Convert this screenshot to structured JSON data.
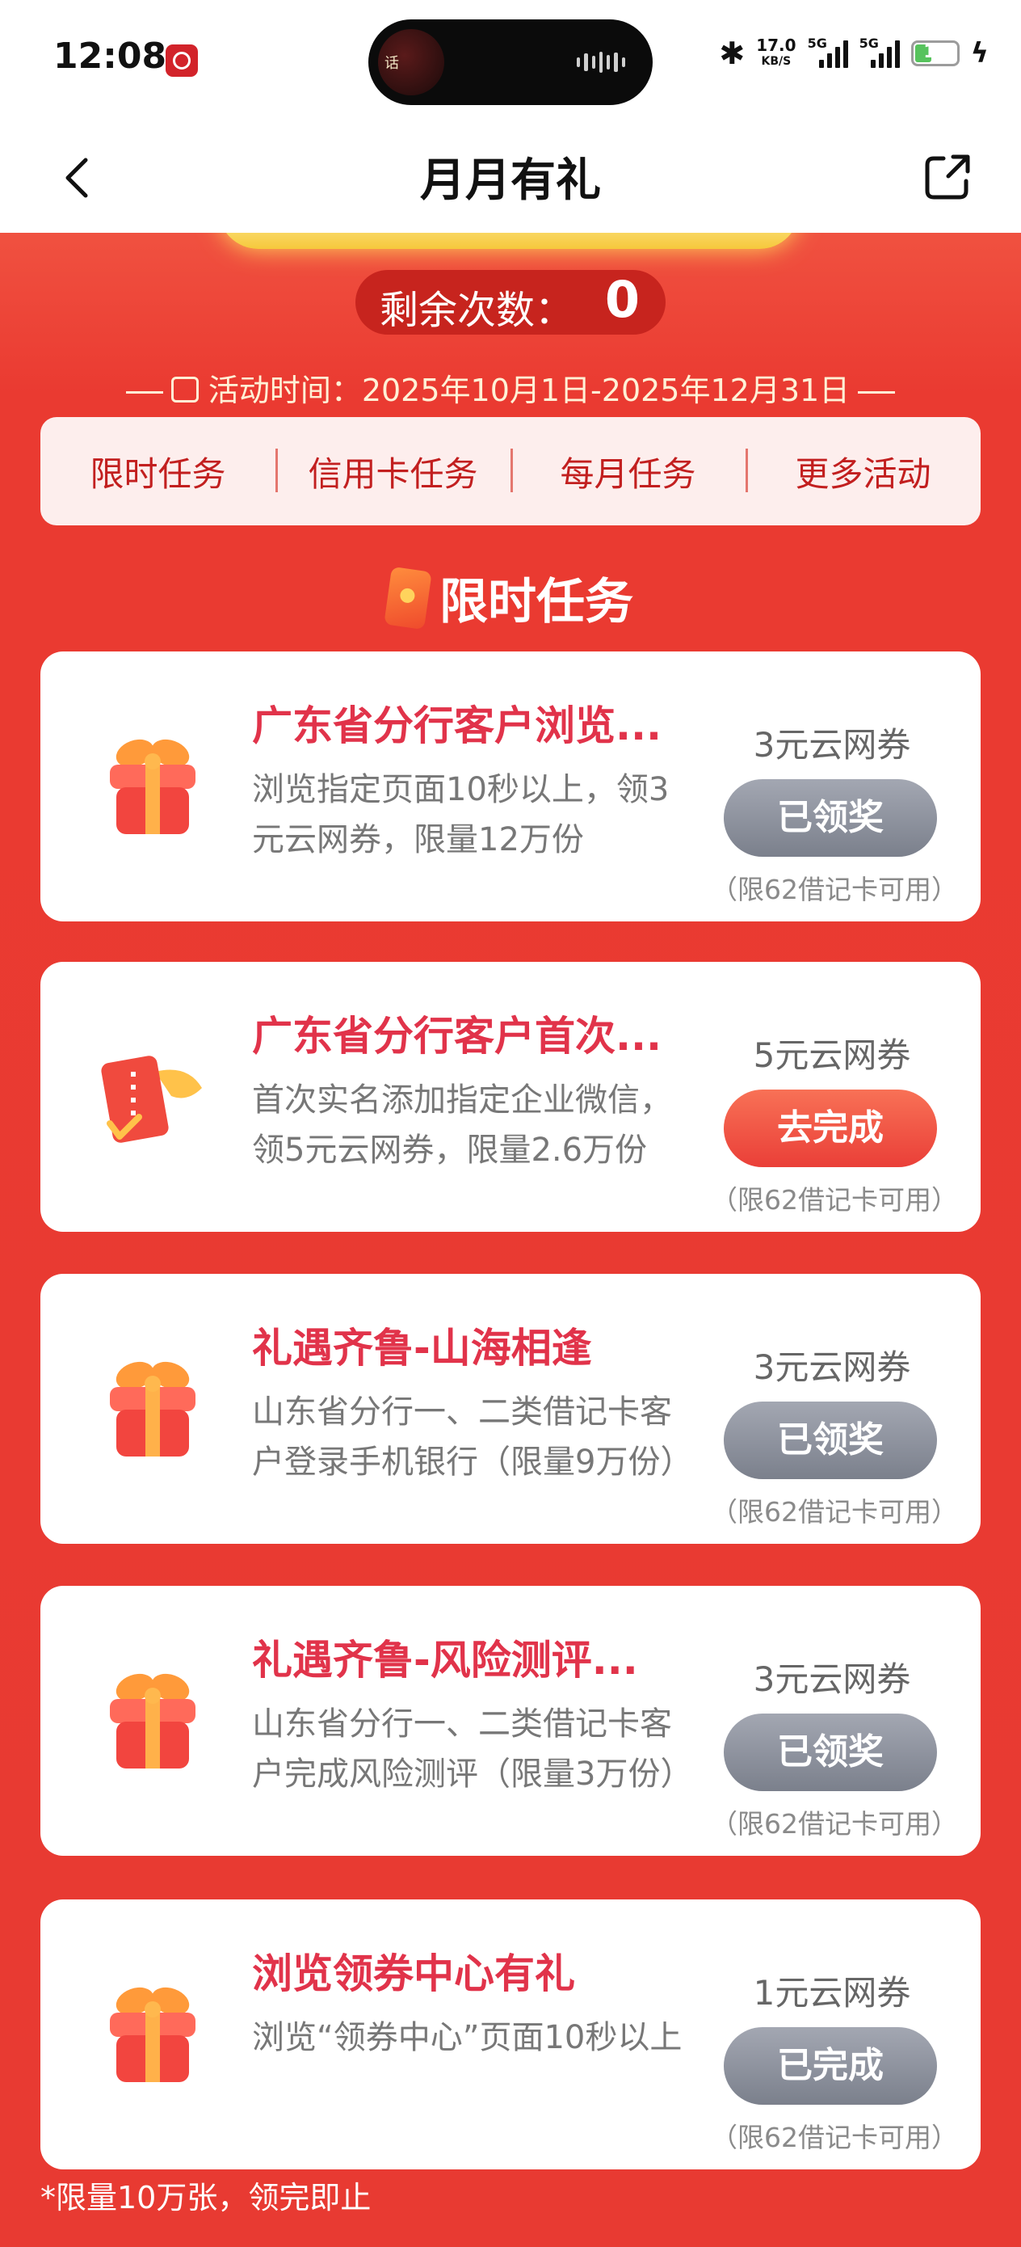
{
  "status_bar": {
    "time": "12:08",
    "net_speed_value": "17.0",
    "net_speed_unit": "KB/S",
    "signal1_label": "5G",
    "signal2_label": "5G",
    "battery": "14",
    "icons": [
      "bank-app-icon",
      "bluetooth-icon",
      "signal-icon",
      "battery-icon",
      "charging-icon"
    ]
  },
  "header": {
    "title": "月月有礼",
    "back_icon": "chevron-left-icon",
    "share_icon": "share-icon"
  },
  "summary": {
    "remaining_label": "剩余次数：",
    "remaining_count": "0",
    "period": "活动时间：2025年10月1日-2025年12月31日"
  },
  "tabs": [
    "限时任务",
    "信用卡任务",
    "每月任务",
    "更多活动"
  ],
  "section": {
    "title": "限时任务"
  },
  "tasks": [
    {
      "title": "广东省分行客户浏览...",
      "desc": "浏览指定页面10秒以上，领3元云网券，限量12万份",
      "reward": "3元云网券",
      "button": "已领奖",
      "note": "（限62借记卡可用）",
      "icon": "gift-icon"
    },
    {
      "title": "广东省分行客户首次...",
      "desc": "首次实名添加指定企业微信，领5元云网券，限量2.6万份",
      "reward": "5元云网券",
      "button": "去完成",
      "note": "（限62借记卡可用）",
      "icon": "card-icon"
    },
    {
      "title": "礼遇齐鲁-山海相逢",
      "desc": "山东省分行一、二类借记卡客户登录手机银行（限量9万份）",
      "reward": "3元云网券",
      "button": "已领奖",
      "note": "（限62借记卡可用）",
      "icon": "gift-icon"
    },
    {
      "title": "礼遇齐鲁-风险测评...",
      "desc": "山东省分行一、二类借记卡客户完成风险测评（限量3万份）",
      "reward": "3元云网券",
      "button": "已领奖",
      "note": "（限62借记卡可用）",
      "icon": "gift-icon"
    },
    {
      "title": "浏览领券中心有礼",
      "desc": "浏览“领券中心”页面10秒以上",
      "reward": "1元云网券",
      "button": "已完成",
      "note": "（限62借记卡可用）",
      "icon": "gift-icon"
    }
  ],
  "footnote": "*限量10万张，领完即止",
  "colors": {
    "primary_red": "#e83a32",
    "title_red": "#e1334a",
    "done_gray": "#8a8f9b",
    "go_red": "#ef4a3b"
  }
}
